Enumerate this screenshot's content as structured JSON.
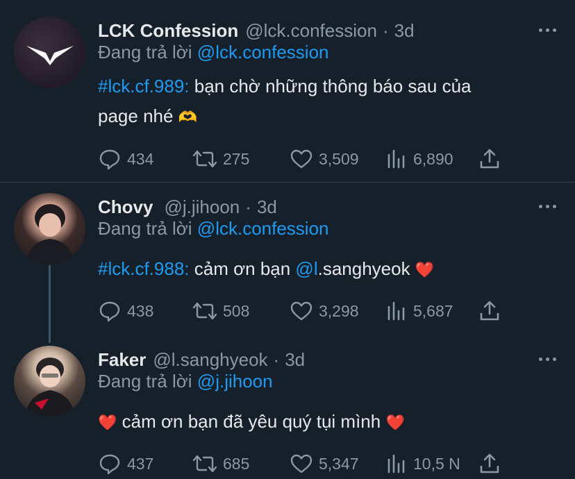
{
  "tweets": [
    {
      "name": "LCK Confession",
      "handle": "@lck.confession",
      "time": "3d",
      "replying_label": "Đang trả lời",
      "replying_to": "@lck.confession",
      "hashtag": "#lck.cf.989:",
      "text_line1": " bạn chờ những thông báo sau của",
      "text_line2": "page nhé ",
      "emoji": "🫶",
      "stats": {
        "replies": "434",
        "retweets": "275",
        "likes": "3,509",
        "views": "6,890"
      }
    },
    {
      "name": "Chovy",
      "handle": "@j.jihoon",
      "time": "3d",
      "replying_label": "Đang trả lời",
      "replying_to": "@lck.confession",
      "hashtag": "#lck.cf.988:",
      "text_before": " cảm ơn bạn ",
      "mention": "@l",
      "mention_rest": ".sanghyeok ",
      "emoji": "❤️",
      "stats": {
        "replies": "438",
        "retweets": "508",
        "likes": "3,298",
        "views": "5,687"
      }
    },
    {
      "name": "Faker",
      "handle": "@l.sanghyeok",
      "time": "3d",
      "replying_label": "Đang trả lời",
      "replying_to": "@j.jihoon",
      "emoji_start": "❤️",
      "text": " cảm ơn bạn đã yêu quý tụi mình ",
      "emoji_end": "❤️",
      "stats": {
        "replies": "437",
        "retweets": "685",
        "likes": "5,347",
        "views": "10,5 N"
      }
    }
  ],
  "separator": "·",
  "colors": {
    "background": "#15202b",
    "link": "#1d9bf0",
    "muted": "#8b98a5",
    "text": "#e7e9ea"
  }
}
